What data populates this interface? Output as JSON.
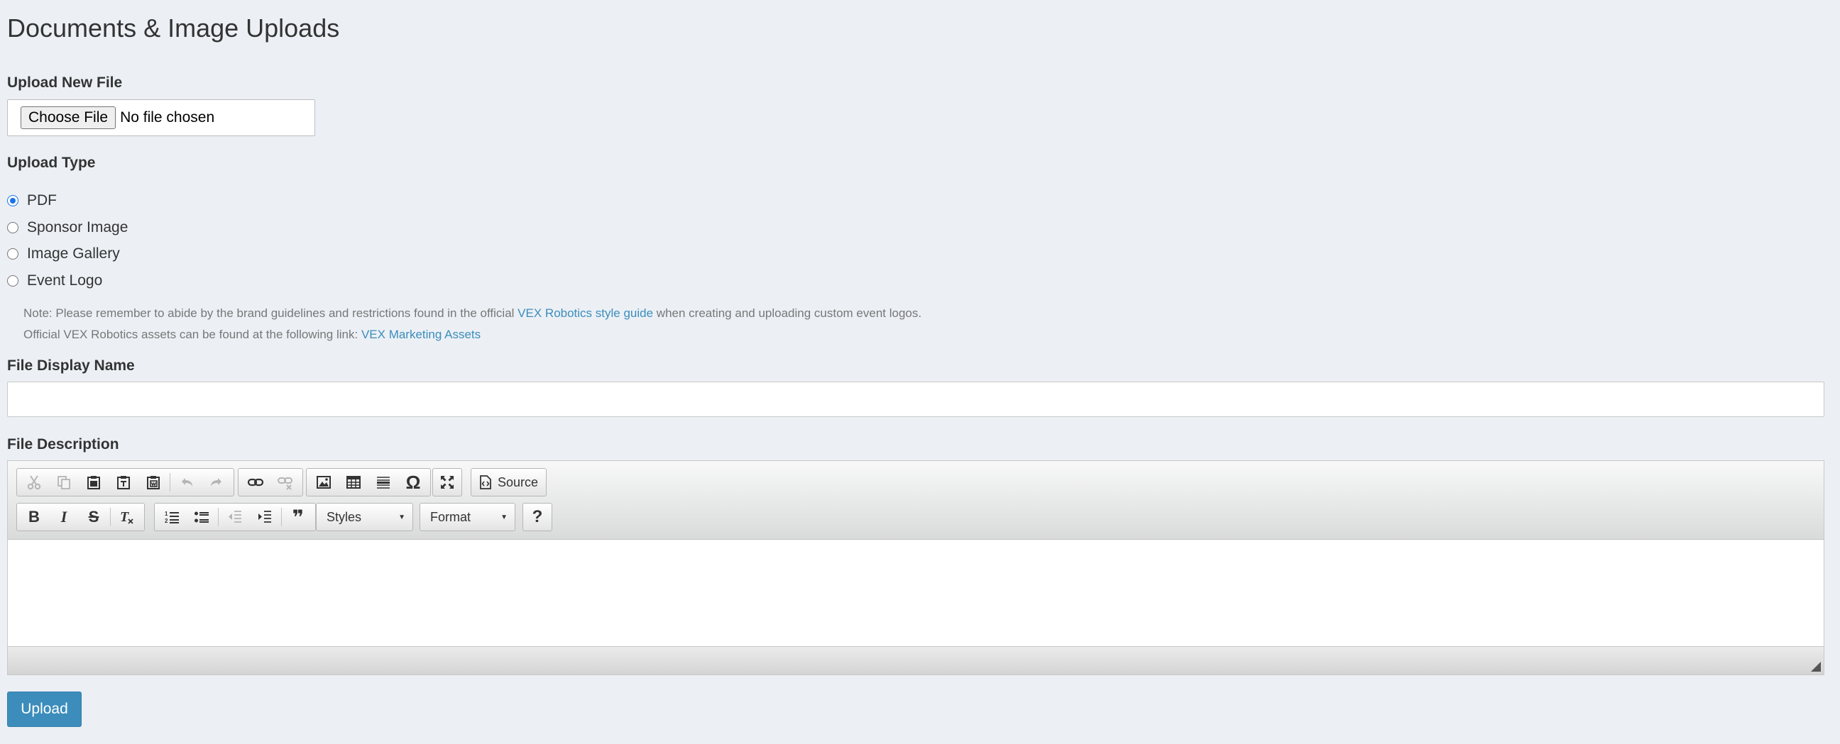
{
  "page": {
    "title": "Documents & Image Uploads"
  },
  "upload_file": {
    "label": "Upload New File",
    "button_label": "Choose File",
    "status": "No file chosen"
  },
  "upload_type": {
    "label": "Upload Type",
    "options": [
      {
        "label": "PDF",
        "checked": true
      },
      {
        "label": "Sponsor Image",
        "checked": false
      },
      {
        "label": "Image Gallery",
        "checked": false
      },
      {
        "label": "Event Logo",
        "checked": false
      }
    ],
    "note_line1_prefix": "Note: Please remember to abide by the brand guidelines and restrictions found in the official",
    "note_line1_link": "VEX Robotics style guide",
    "note_line1_suffix": "when creating and uploading custom event logos.",
    "note_line2_prefix": "Official VEX Robotics assets can be found at the following link:",
    "note_line2_link": "VEX Marketing Assets"
  },
  "display_name": {
    "label": "File Display Name",
    "value": ""
  },
  "description": {
    "label": "File Description",
    "toolbar": {
      "row1": [
        "cut-icon",
        "copy-icon",
        "paste-icon",
        "paste-text-icon",
        "paste-word-icon",
        "undo-icon",
        "redo-icon",
        "link-icon",
        "unlink-icon",
        "image-icon",
        "table-icon",
        "horizontal-rule-icon",
        "special-char-icon",
        "maximize-icon"
      ],
      "source_label": "Source",
      "bold_glyph": "B",
      "italic_glyph": "I",
      "strike_glyph": "S",
      "remove_format_glyph": "T",
      "blockquote_glyph": "❞",
      "help_glyph": "?",
      "styles_label": "Styles",
      "format_label": "Format"
    }
  },
  "actions": {
    "upload_label": "Upload"
  },
  "colors": {
    "background": "#ecf0f5",
    "primary": "#3c8dbc",
    "link": "#3c8dbc",
    "radio_checked": "#1a73e8"
  }
}
